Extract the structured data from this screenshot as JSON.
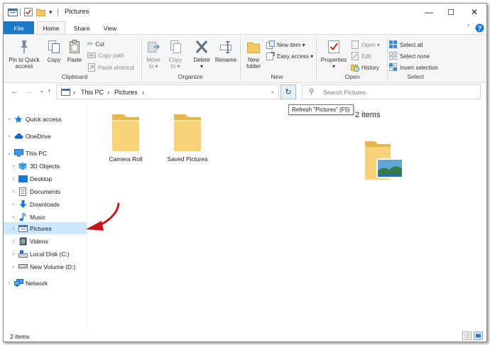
{
  "window": {
    "title": "Pictures"
  },
  "quick_access_toolbar": {
    "customize_symbol": "▾"
  },
  "window_controls": {
    "minimize": "—",
    "maximize": "☐",
    "close": "✕"
  },
  "ribbon_tabs": {
    "file": "File",
    "home": "Home",
    "share": "Share",
    "view": "View"
  },
  "ribbon": {
    "clipboard": {
      "pin_label_1": "Pin to Quick",
      "pin_label_2": "access",
      "copy": "Copy",
      "paste": "Paste",
      "cut": "Cut",
      "copy_path": "Copy path",
      "paste_shortcut": "Paste shortcut",
      "group_label": "Clipboard"
    },
    "organize": {
      "move_to": "Move",
      "move_to_2": "to ▾",
      "copy_to": "Copy",
      "copy_to_2": "to ▾",
      "delete": "Delete",
      "delete_2": "▾",
      "rename": "Rename",
      "group_label": "Organize"
    },
    "new": {
      "new_folder_1": "New",
      "new_folder_2": "folder",
      "new_item": "New item ▾",
      "easy_access": "Easy access ▾",
      "group_label": "New"
    },
    "open": {
      "properties": "Properties",
      "properties_2": "▾",
      "open": "Open ▾",
      "edit": "Edit",
      "history": "History",
      "group_label": "Open"
    },
    "select": {
      "select_all": "Select all",
      "select_none": "Select none",
      "invert_selection": "Invert selection",
      "group_label": "Select"
    }
  },
  "address_bar": {
    "back": "←",
    "forward": "→",
    "recent": "⌄",
    "up": "↑",
    "crumbs": [
      "This PC",
      "Pictures"
    ],
    "separator": "›",
    "dropdown": "⌄",
    "refresh": "↻",
    "search_placeholder": "Search Pictures"
  },
  "tooltip": "Refresh \"Pictures\" (F5)",
  "nav_pane": [
    {
      "label": "Quick access",
      "icon": "star-icon",
      "indent": 0
    },
    {
      "label": "OneDrive",
      "icon": "cloud-icon",
      "indent": 0
    },
    {
      "label": "This PC",
      "icon": "computer-icon",
      "indent": 0,
      "expanded": true
    },
    {
      "label": "3D Objects",
      "icon": "cube-icon",
      "indent": 1
    },
    {
      "label": "Desktop",
      "icon": "desktop-icon",
      "indent": 1
    },
    {
      "label": "Documents",
      "icon": "documents-icon",
      "indent": 1
    },
    {
      "label": "Downloads",
      "icon": "download-icon",
      "indent": 1
    },
    {
      "label": "Music",
      "icon": "music-icon",
      "indent": 1
    },
    {
      "label": "Pictures",
      "icon": "pictures-icon",
      "indent": 1,
      "selected": true
    },
    {
      "label": "Videos",
      "icon": "videos-icon",
      "indent": 1
    },
    {
      "label": "Local Disk (C:)",
      "icon": "local-disk-icon",
      "indent": 1
    },
    {
      "label": "New Volume (D:)",
      "icon": "drive-icon",
      "indent": 1
    },
    {
      "label": "Network",
      "icon": "network-icon",
      "indent": 0
    }
  ],
  "files": [
    {
      "name": "Camera Roll",
      "icon": "folder-icon"
    },
    {
      "name": "Saved Pictures",
      "icon": "folder-icon"
    }
  ],
  "preview": {
    "item_count": "2 items"
  },
  "status_bar": {
    "item_count": "2 items"
  },
  "colors": {
    "file_tab": "#1979ca",
    "selection": "#cce8ff",
    "folder": "#f3c95f",
    "annotation_arrow": "#c4161c",
    "help_button": "#1979ca"
  }
}
